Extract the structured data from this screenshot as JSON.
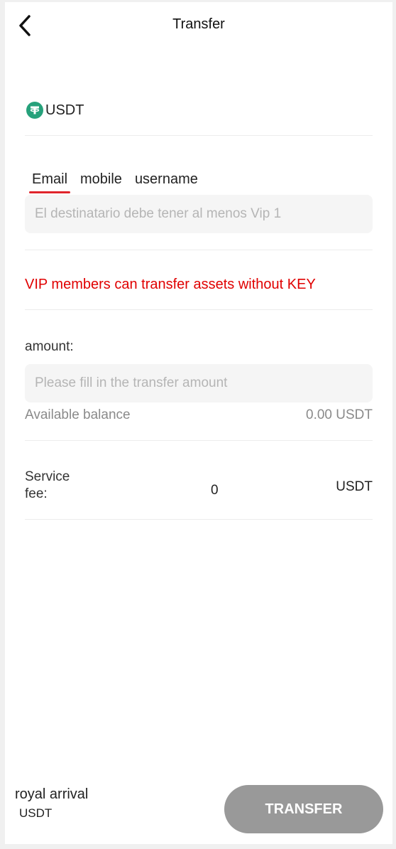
{
  "header": {
    "title": "Transfer"
  },
  "coin": {
    "icon": "tether-icon",
    "label": "USDT",
    "icon_color": "#26a17b"
  },
  "recipient": {
    "tabs": [
      {
        "label": "Email",
        "active": true
      },
      {
        "label": "mobile",
        "active": false
      },
      {
        "label": "username",
        "active": false
      }
    ],
    "placeholder": "El destinatario debe tener al menos Vip 1",
    "value": ""
  },
  "notice": {
    "text": "VIP members can transfer assets without KEY",
    "color": "#e00000"
  },
  "amount": {
    "label": "amount:",
    "placeholder": "Please fill in the transfer amount",
    "value": "",
    "available_label": "Available balance",
    "available_value": "0.00 USDT"
  },
  "fee": {
    "label": "Service fee:",
    "value": "0",
    "unit": "USDT"
  },
  "footer": {
    "arrival_label": "royal arrival",
    "arrival_unit": "USDT",
    "transfer_button": "TRANSFER",
    "button_color": "#999999"
  },
  "accent_color": "#e0242b"
}
